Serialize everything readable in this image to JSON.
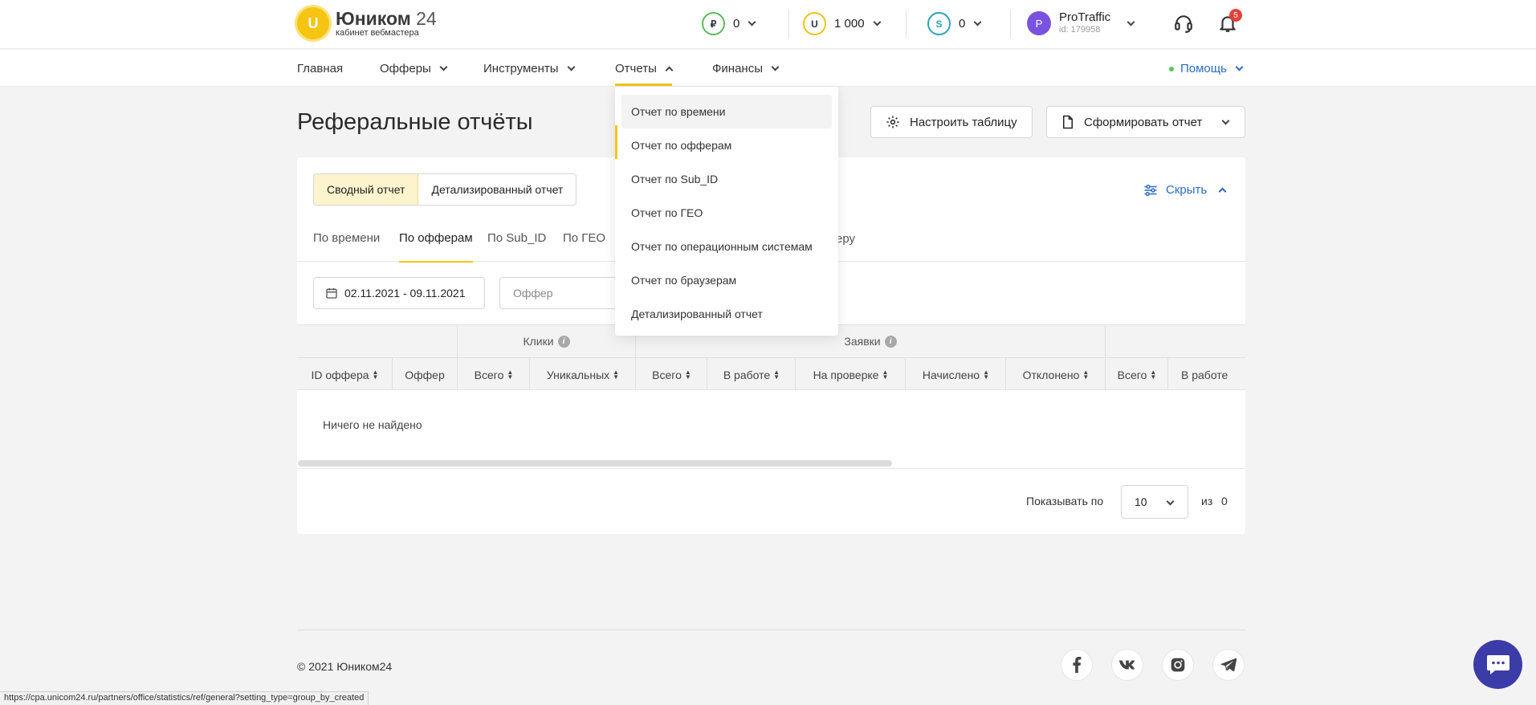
{
  "header": {
    "logo_letter": "U",
    "logo_name": "Юником",
    "logo_number": "24",
    "logo_subtitle": "кабинет вебмастера",
    "balances": [
      {
        "symbol": "₽",
        "value": "0",
        "color": "#5cb85c"
      },
      {
        "symbol": "U",
        "value": "1 000",
        "color": "#f0c20f"
      },
      {
        "symbol": "S",
        "value": "0",
        "color": "#29a3bf"
      }
    ],
    "user": {
      "initial": "P",
      "name": "ProTraffic",
      "id": "id: 179958"
    },
    "notifications_count": "5",
    "icons": [
      "headset-icon",
      "bell-icon"
    ]
  },
  "nav": {
    "items": [
      "Главная",
      "Офферы",
      "Инструменты",
      "Отчеты",
      "Финансы"
    ],
    "active": "Отчеты",
    "help": "Помощь"
  },
  "page": {
    "title": "Реферальные отчёты",
    "configure_button": "Настроить таблицу",
    "generate_button": "Сформировать отчет"
  },
  "report_type": {
    "options": [
      "Сводный отчет",
      "Детализированный отчет"
    ],
    "selected": "Сводный отчет",
    "hide_label": "Скрыть"
  },
  "tabs": {
    "items": [
      "По времени",
      "По офферам",
      "По Sub_ID",
      "По ГЕО"
    ],
    "tail_text": "еру",
    "active": "По офферам"
  },
  "filters": {
    "date_range": "02.11.2021 - 09.11.2021",
    "offer_placeholder": "Оффер"
  },
  "dropdown": {
    "items": [
      "Отчет по времени",
      "Отчет по офферам",
      "Отчет по Sub_ID",
      "Отчет по ГЕО",
      "Отчет по операционным системам",
      "Отчет по браузерам",
      "Детализированный отчет"
    ],
    "hovered": "Отчет по времени"
  },
  "table": {
    "groups": [
      "Клики",
      "Заявки"
    ],
    "columns": [
      "ID оффера",
      "Оффер",
      "Всего",
      "Уникальных",
      "Всего",
      "В работе",
      "На проверке",
      "Начислено",
      "Отклонено",
      "Всего",
      "В работе"
    ],
    "empty_text": "Ничего не найдено"
  },
  "pagination": {
    "show_label": "Показывать по",
    "page_size": "10",
    "of_label": "из",
    "total": "0"
  },
  "footer": {
    "copyright": "© 2021 Юником24",
    "socials": [
      "facebook-icon",
      "vk-icon",
      "instagram-icon",
      "telegram-icon"
    ]
  },
  "statusbar": {
    "url": "https://cpa.unicom24.ru/partners/office/statistics/ref/general?setting_type=group_by_created"
  },
  "colors": {
    "accent": "#f5c518",
    "link": "#2a6cc4",
    "badge": "#e5413a",
    "chat": "#3c3ca8"
  }
}
